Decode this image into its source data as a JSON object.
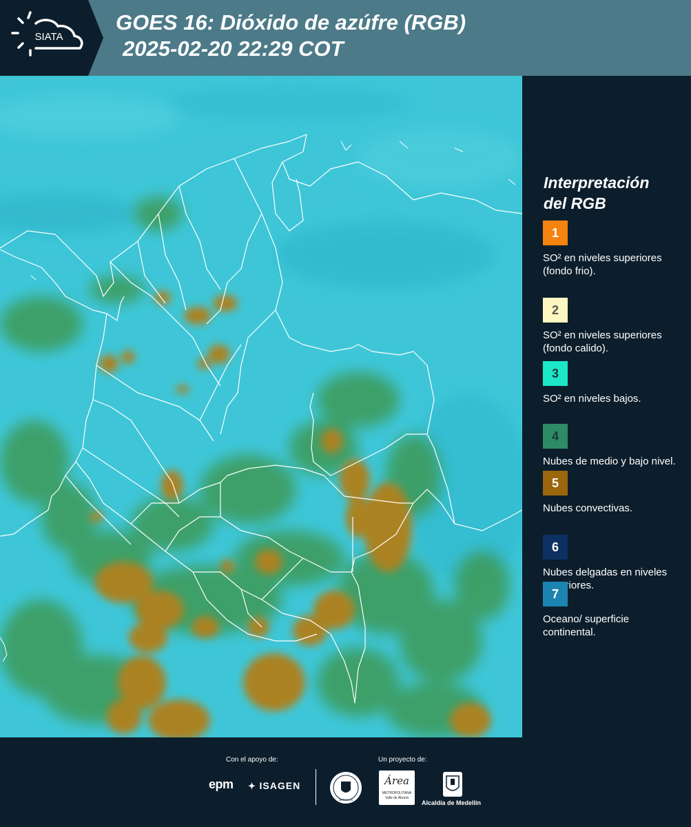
{
  "header": {
    "logo_text": "SIATA",
    "title_line1": "GOES 16: Dióxido de azúfre (RGB)",
    "title_line2": "2025-02-20 22:29 COT"
  },
  "legend": {
    "title_line1": "Interpretación",
    "title_line2": "del RGB",
    "items": [
      {
        "number": "1",
        "color": "#f5830f",
        "label": "SO² en niveles superiores (fondo frio)."
      },
      {
        "number": "2",
        "color": "#fdf6c1",
        "label": "SO² en niveles superiores (fondo calido)."
      },
      {
        "number": "3",
        "color": "#1ce8c8",
        "label": "SO² en niveles bajos."
      },
      {
        "number": "4",
        "color": "#2e8c64",
        "label": "Nubes de medio y bajo nivel."
      },
      {
        "number": "5",
        "color": "#9c660c",
        "label": "Nubes convectivas."
      },
      {
        "number": "6",
        "color": "#0c3062",
        "label": "Nubes delgadas en niveles superiores."
      },
      {
        "number": "7",
        "color": "#1c84b0",
        "label": "Oceano/ superficie continental."
      }
    ]
  },
  "footer": {
    "support_label": "Con el apoyo de:",
    "project_label": "Un proyecto de:",
    "epm": "epm",
    "isagen": "ISAGEN",
    "area_name": "Área",
    "area_sub1": "METROPOLITANA",
    "area_sub2": "Valle de Aburrá",
    "alcaldia": "Alcaldía de Medellín",
    "seal_text": "MEDELLIN"
  },
  "map": {
    "background_color": "#3cc6d6",
    "cloud_green": "#3f9a55",
    "cloud_brown": "#a8822a",
    "border_color": "#ffffff"
  }
}
